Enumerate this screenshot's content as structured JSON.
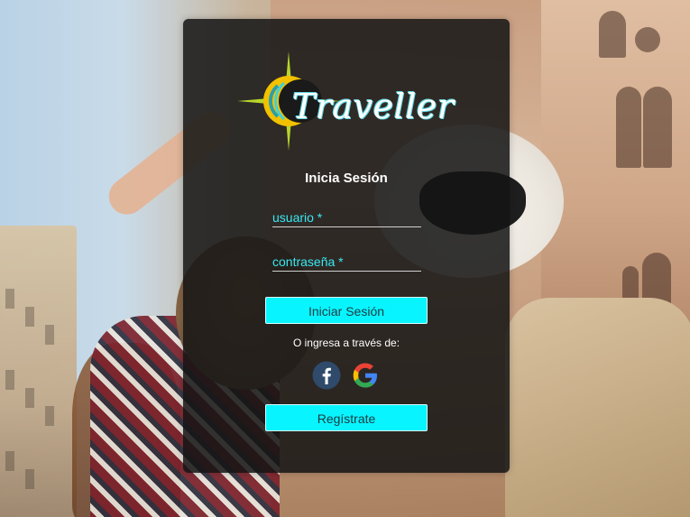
{
  "brand": {
    "name": "Traveller",
    "colors": {
      "accent": "#08f5ff",
      "field_text": "#39e8f2",
      "card_bg": "rgba(20,20,20,0.86)",
      "logo_sun": "#f2c100",
      "logo_star": "#b6d62a"
    }
  },
  "login": {
    "title": "Inicia Sesión",
    "username_placeholder": "usuario *",
    "password_placeholder": "contraseña *",
    "submit_label": "Iniciar Sesión",
    "social_prompt": "O ingresa a través de:",
    "social": [
      {
        "icon": "facebook-icon"
      },
      {
        "icon": "google-icon"
      }
    ],
    "register_label": "Regístrate"
  }
}
